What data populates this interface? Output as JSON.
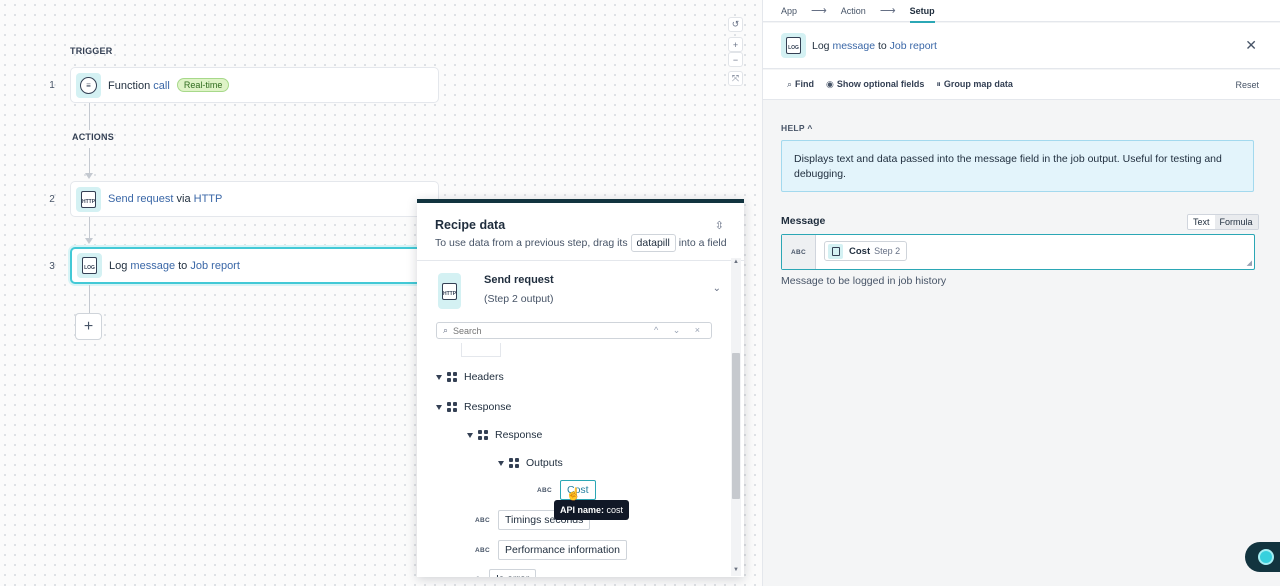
{
  "canvas": {
    "trigger_label": "TRIGGER",
    "actions_label": "ACTIONS",
    "steps": [
      {
        "num": "1",
        "icon": "function-call-icon",
        "parts": [
          "Function",
          "call"
        ],
        "badge": "Real-time"
      },
      {
        "num": "2",
        "icon": "http-doc-icon",
        "icon_text": "HTTP",
        "parts": [
          "Send request",
          "via",
          "HTTP"
        ]
      },
      {
        "num": "3",
        "icon": "log-doc-icon",
        "icon_text": "LOG",
        "parts": [
          "Log",
          "message",
          "to",
          "Job report"
        ]
      }
    ],
    "add_label": "+",
    "zoom_controls": [
      "↺",
      "+",
      "−",
      "⤧"
    ]
  },
  "recipe": {
    "title": "Recipe data",
    "subtitle_pre": "To use data from a previous step, drag its",
    "subtitle_pill": "datapill",
    "subtitle_post": "into a field",
    "source_title": "Send request",
    "source_sub": "(Step 2 output)",
    "source_icon_text": "HTTP",
    "search_placeholder": "Search",
    "tree": {
      "headers": "Headers",
      "response": "Response",
      "response_inner": "Response",
      "outputs": "Outputs",
      "cost": "Cost",
      "timings": "Timings seconds",
      "performance": "Performance information",
      "is_error": "Is error",
      "abc": "ABC"
    },
    "tooltip_key": "API name:",
    "tooltip_val": "cost"
  },
  "right": {
    "crumbs": [
      "App",
      "Action",
      "Setup"
    ],
    "header_parts": [
      "Log",
      "message",
      "to",
      "Job report"
    ],
    "header_icon_text": "LOG",
    "toolbar": {
      "find": "Find",
      "optional": "Show optional fields",
      "group": "Group map data",
      "reset": "Reset"
    },
    "help_label": "HELP",
    "help_text": "Displays text and data passed into the message field in the job output. Useful for testing and debugging.",
    "message_label": "Message",
    "mode_text": "Text",
    "mode_formula": "Formula",
    "field_type": "ABC",
    "pill_name": "Cost",
    "pill_step": "Step 2",
    "message_help": "Message to be logged in job history"
  },
  "colors": {
    "accent": "#2ba7b5",
    "link": "#3a67a7",
    "dark": "#12343f",
    "help_bg": "#e3f4fb"
  }
}
